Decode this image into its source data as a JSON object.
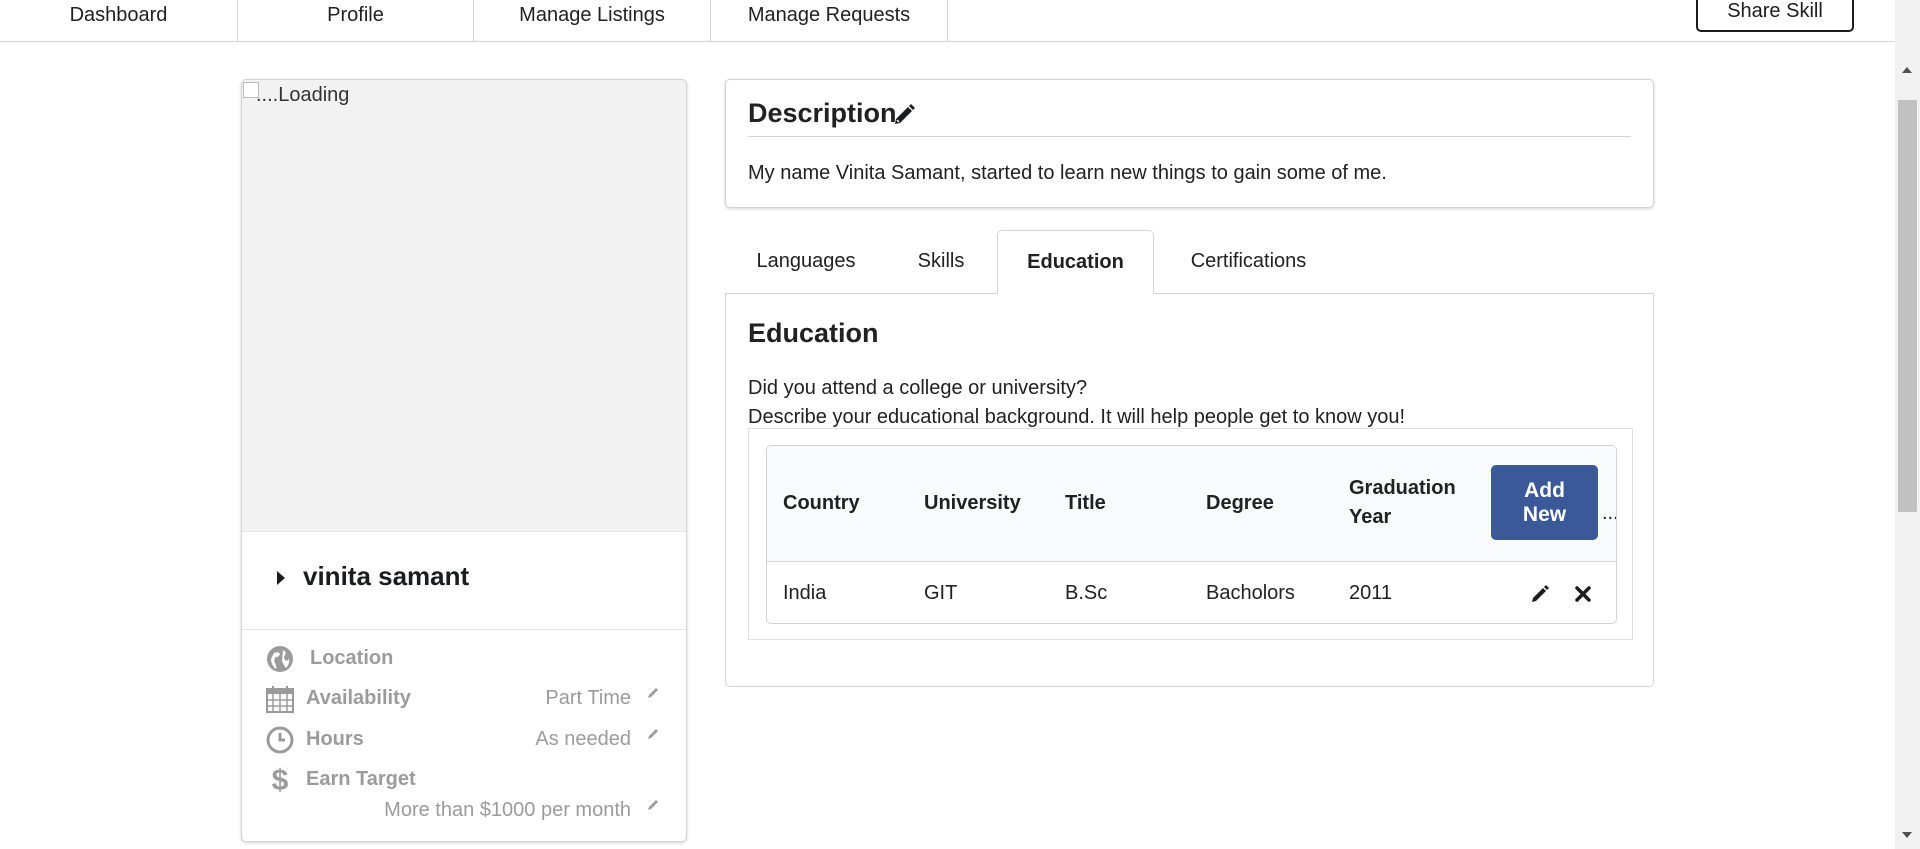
{
  "nav": {
    "items": [
      "Dashboard",
      "Profile",
      "Manage Listings",
      "Manage Requests"
    ],
    "share_button": "Share Skill"
  },
  "profile": {
    "photo_alt": "....Loading",
    "name": "vinita samant",
    "location_label": "Location",
    "availability_label": "Availability",
    "availability_value": "Part Time",
    "hours_label": "Hours",
    "hours_value": "As needed",
    "earn_label": "Earn Target",
    "earn_value": "More than $1000 per month",
    "icons": [
      "globe-icon",
      "calendar-icon",
      "clock-icon",
      "dollar-icon",
      "pencil-icon"
    ]
  },
  "description": {
    "title": "Description",
    "text": "My name Vinita Samant, started to learn new things to gain some of me."
  },
  "tabs": [
    "Languages",
    "Skills",
    "Education",
    "Certifications"
  ],
  "active_tab": "Education",
  "education": {
    "title": "Education",
    "line1": "Did you attend a college or university?",
    "line2": "Describe your educational background. It will help people get to know you!",
    "headers": {
      "country": "Country",
      "university": "University",
      "title": "Title",
      "degree": "Degree",
      "year_1": "Graduation",
      "year_2": "Year"
    },
    "add_line1": "Add",
    "add_line2": "New",
    "ellipsis": "...",
    "rows": [
      {
        "country": "India",
        "university": "GIT",
        "title": "B.Sc",
        "degree": "Bacholors",
        "year": "2011"
      }
    ]
  },
  "colors": {
    "primary_button": "#3b5998",
    "muted_text": "#9b9b9b",
    "border": "#d4d4d5"
  }
}
